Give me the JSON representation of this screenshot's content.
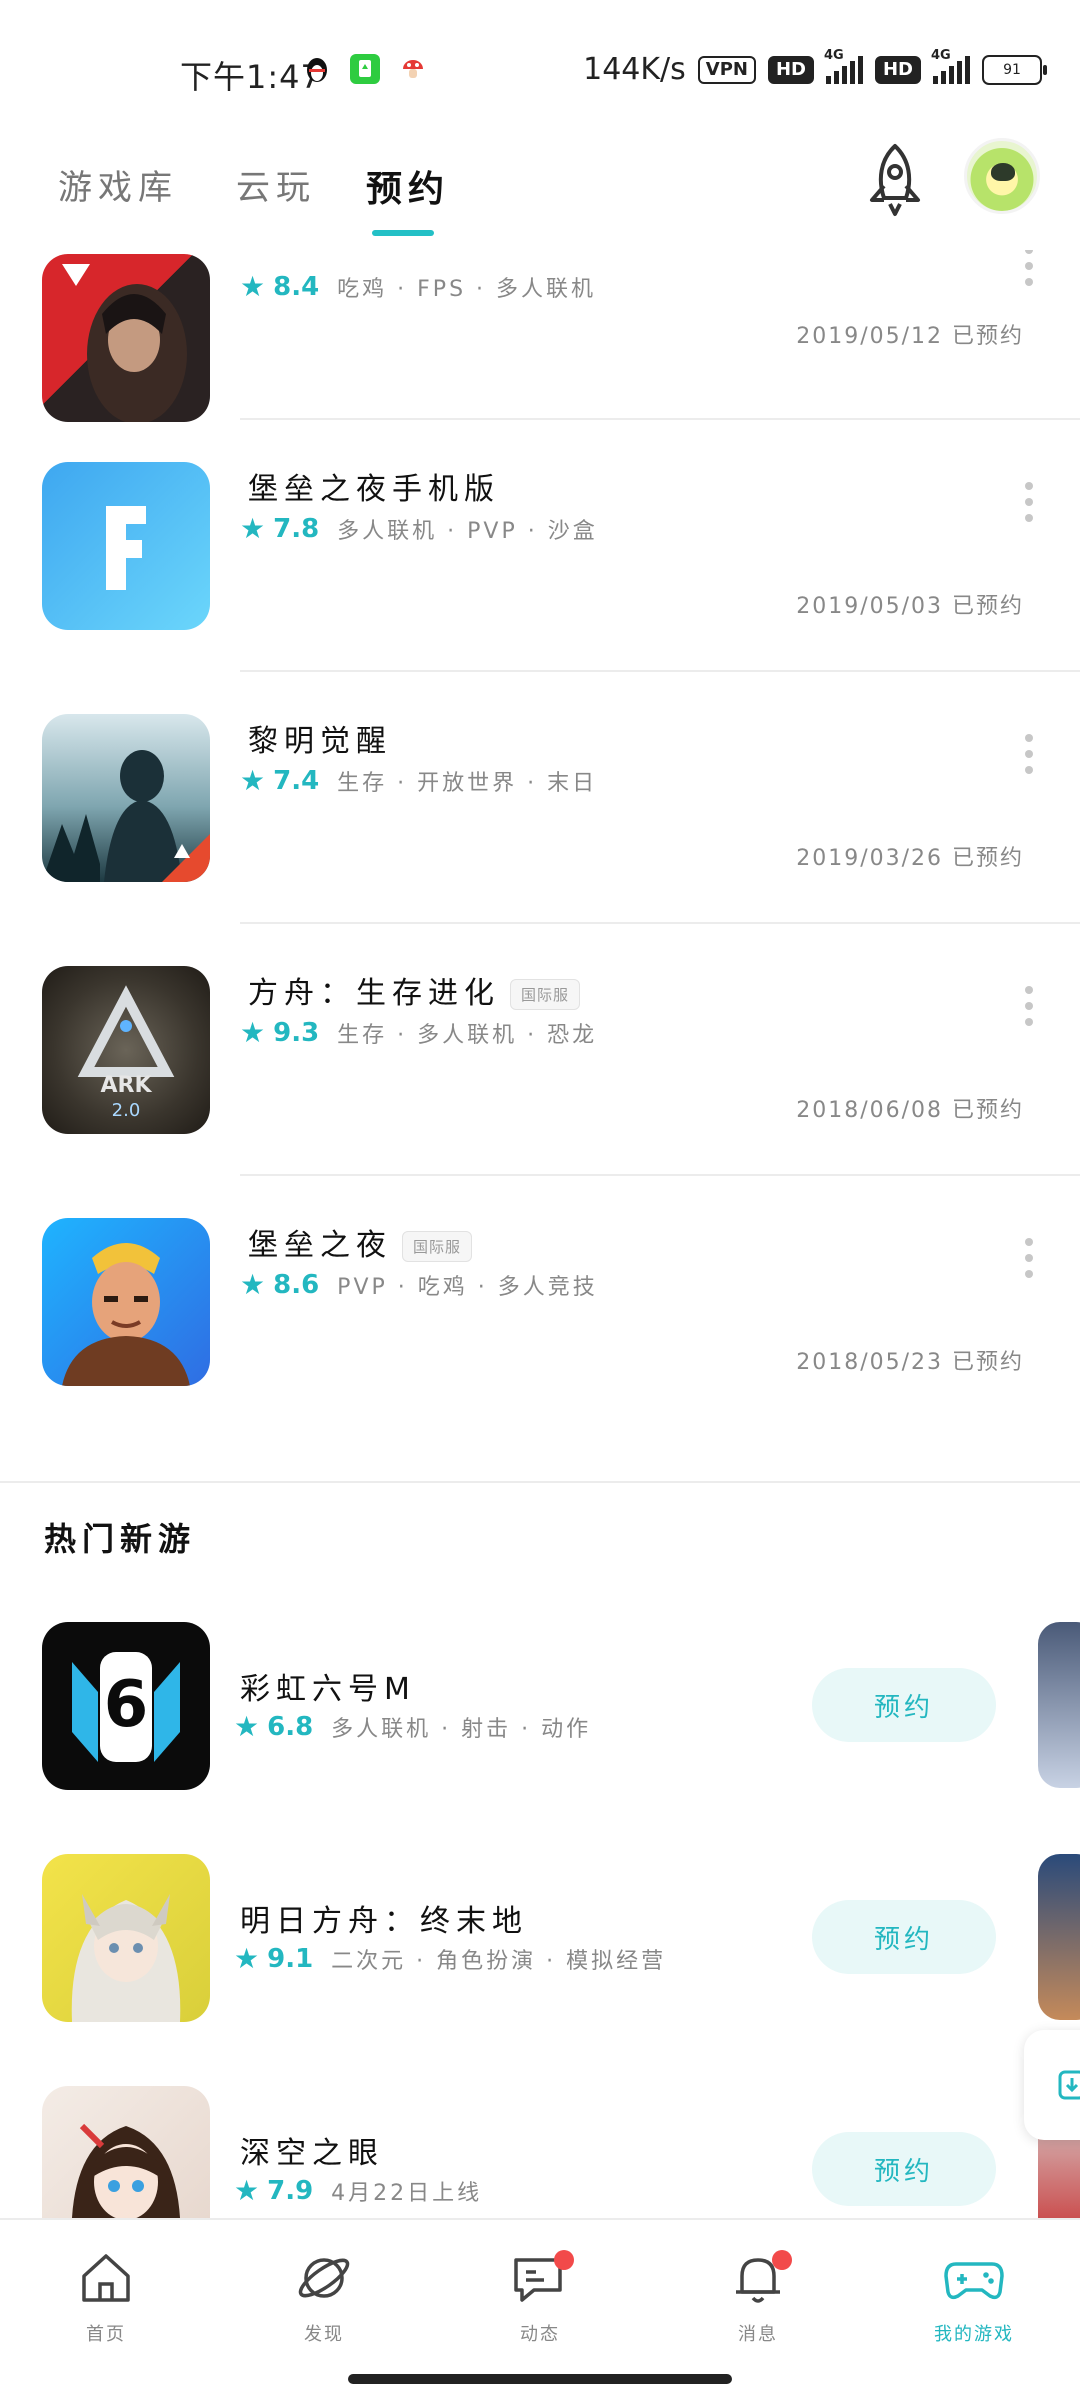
{
  "status_bar": {
    "time": "下午1:47",
    "net_speed": "144K/s",
    "vpn": "VPN",
    "hd": "HD",
    "network": "4G",
    "battery": "91"
  },
  "top_tabs": [
    {
      "label": "游戏库",
      "active": false
    },
    {
      "label": "云玩",
      "active": false
    },
    {
      "label": "预约",
      "active": true
    }
  ],
  "reservations": [
    {
      "name": "",
      "score": "8.4",
      "tags": "吃鸡 · FPS · 多人联机",
      "date": "2019/05/12 已预约",
      "badge": ""
    },
    {
      "name": "堡垒之夜手机版",
      "score": "7.8",
      "tags": "多人联机 · PVP · 沙盒",
      "date": "2019/05/03 已预约",
      "badge": ""
    },
    {
      "name": "黎明觉醒",
      "score": "7.4",
      "tags": "生存 · 开放世界 · 末日",
      "date": "2019/03/26 已预约",
      "badge": ""
    },
    {
      "name": "方舟：生存进化",
      "score": "9.3",
      "tags": "生存 · 多人联机 · 恐龙",
      "date": "2018/06/08 已预约",
      "badge": "国际服"
    },
    {
      "name": "堡垒之夜",
      "score": "8.6",
      "tags": "PVP · 吃鸡 · 多人竞技",
      "date": "2018/05/23 已预约",
      "badge": "国际服"
    }
  ],
  "hot_section": {
    "title": "热门新游",
    "items": [
      {
        "name": "彩虹六号M",
        "score": "6.8",
        "tags": "多人联机 · 射击 · 动作",
        "button": "预约"
      },
      {
        "name": "明日方舟：终末地",
        "score": "9.1",
        "tags": "二次元 · 角色扮演 · 模拟经营",
        "button": "预约"
      },
      {
        "name": "深空之眼",
        "score": "7.9",
        "tags": "4月22日上线",
        "button": "预约"
      }
    ]
  },
  "bottom_nav": [
    {
      "label": "首页",
      "icon": "home-icon",
      "badge": false,
      "active": false
    },
    {
      "label": "发现",
      "icon": "planet-icon",
      "badge": false,
      "active": false
    },
    {
      "label": "动态",
      "icon": "chat-icon",
      "badge": true,
      "active": false
    },
    {
      "label": "消息",
      "icon": "bell-icon",
      "badge": true,
      "active": false
    },
    {
      "label": "我的游戏",
      "icon": "gamepad-icon",
      "badge": false,
      "active": true
    }
  ],
  "colors": {
    "accent": "#23b7c0",
    "reserve_button_bg": "#e8f8f8",
    "badge_red": "#f24a4a"
  }
}
